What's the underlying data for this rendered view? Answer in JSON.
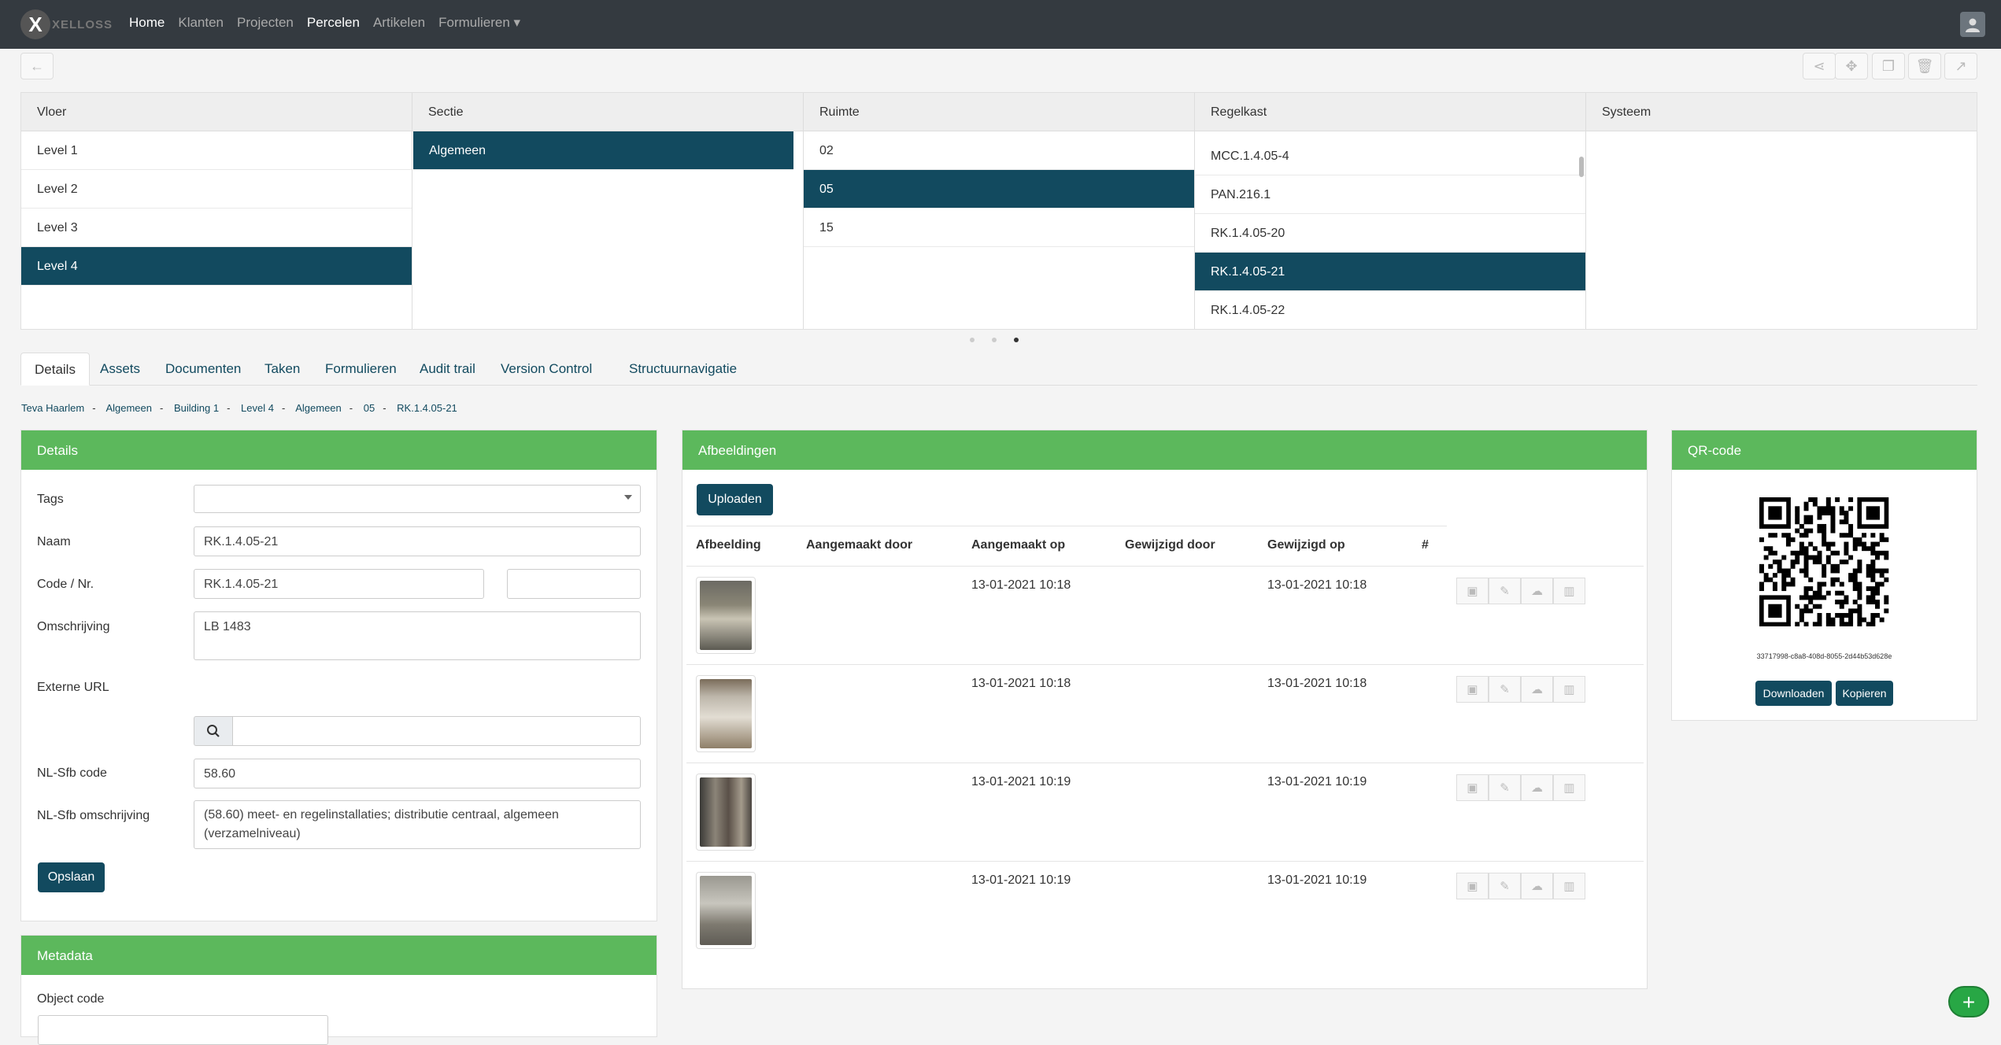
{
  "nav": {
    "logo_text": "XELLOSS",
    "items": [
      {
        "label": "Home",
        "active": true
      },
      {
        "label": "Klanten",
        "active": false
      },
      {
        "label": "Projecten",
        "active": false
      },
      {
        "label": "Percelen",
        "active": true
      },
      {
        "label": "Artikelen",
        "active": false
      },
      {
        "label": "Formulieren ▾",
        "active": false
      }
    ]
  },
  "toolbar": {
    "back_icon": "arrow-left-icon",
    "right_icons": [
      "share-icon",
      "move-icon",
      "copy-icon",
      "trash-icon",
      "chart-icon"
    ]
  },
  "columns": [
    {
      "header": "Vloer",
      "items": [
        "Level 1",
        "Level 2",
        "Level 3",
        "Level 4"
      ],
      "selected": 3
    },
    {
      "header": "Sectie",
      "items": [
        "Algemeen"
      ],
      "selected": 0
    },
    {
      "header": "Ruimte",
      "items": [
        "02",
        "05",
        "15"
      ],
      "selected": 1
    },
    {
      "header": "Regelkast",
      "items": [
        "MCC.1.4.05-4",
        "PAN.216.1",
        "RK.1.4.05-20",
        "RK.1.4.05-21",
        "RK.1.4.05-22"
      ],
      "selected": 3
    },
    {
      "header": "Systeem",
      "items": [],
      "selected": -1
    }
  ],
  "tabs": [
    "Details",
    "Assets",
    "Documenten",
    "Taken",
    "Formulieren",
    "Audit trail",
    "Version Control",
    "Structuurnavigatie"
  ],
  "breadcrumb": [
    "Teva Haarlem",
    "Algemeen",
    "Building 1",
    "Level 4",
    "Algemeen",
    "05",
    "RK.1.4.05-21"
  ],
  "details": {
    "title": "Details",
    "tags_label": "Tags",
    "naam_label": "Naam",
    "naam_value": "RK.1.4.05-21",
    "code_label": "Code / Nr.",
    "code_value": "RK.1.4.05-21",
    "code_extra": "",
    "omschrijving_label": "Omschrijving",
    "omschrijving_value": "LB 1483",
    "url_label": "Externe URL",
    "url_value": "",
    "sfb_code_label": "NL-Sfb code",
    "sfb_code_value": "58.60",
    "sfb_omschr_label": "NL-Sfb omschrijving",
    "sfb_omschr_value": "(58.60) meet- en regelinstallaties; distributie centraal, algemeen (verzamelniveau)",
    "save_label": "Opslaan"
  },
  "metadata": {
    "title": "Metadata",
    "object_code_label": "Object code"
  },
  "images": {
    "title": "Afbeeldingen",
    "upload_label": "Uploaden",
    "headers": [
      "Afbeelding",
      "Aangemaakt door",
      "Aangemaakt op",
      "Gewijzigd door",
      "Gewijzigd op",
      "#"
    ],
    "rows": [
      {
        "created_by": "",
        "created_on": "13-01-2021 10:18",
        "modified_by": "",
        "modified_on": "13-01-2021 10:18"
      },
      {
        "created_by": "",
        "created_on": "13-01-2021 10:18",
        "modified_by": "",
        "modified_on": "13-01-2021 10:18"
      },
      {
        "created_by": "",
        "created_on": "13-01-2021 10:19",
        "modified_by": "",
        "modified_on": "13-01-2021 10:19"
      },
      {
        "created_by": "",
        "created_on": "13-01-2021 10:19",
        "modified_by": "",
        "modified_on": "13-01-2021 10:19"
      }
    ],
    "row_icons": [
      "image-icon",
      "pencil-icon",
      "cloud-download-icon",
      "trash-icon"
    ]
  },
  "qr": {
    "title": "QR-code",
    "id_text": "33717998-c8a8-408d-8055-2d44b53d628e",
    "download_label": "Downloaden",
    "copy_label": "Kopieren"
  },
  "colors": {
    "topbar": "#343a40",
    "accent": "#124a5f",
    "panel_header": "#5cb85c",
    "fab": "#28a745"
  }
}
